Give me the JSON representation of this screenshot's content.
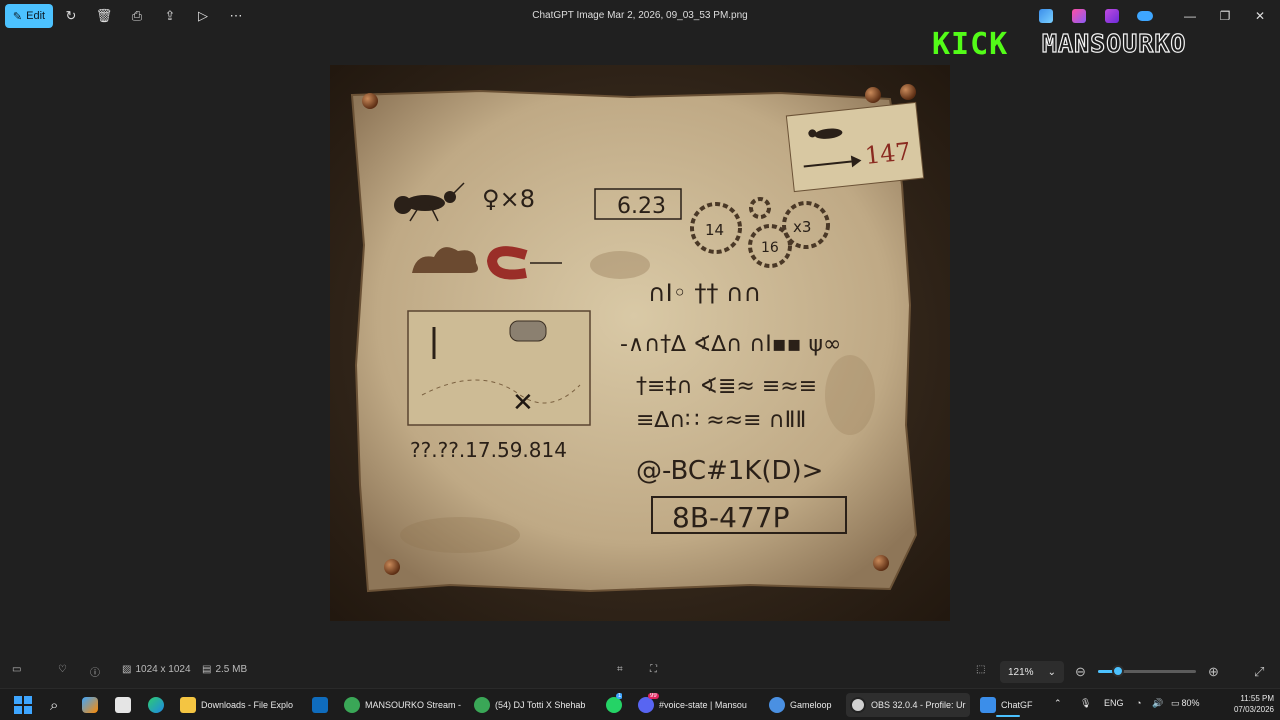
{
  "app": {
    "title": "ChatGPT Image Mar 2, 2026, 09_03_53 PM.png",
    "edit_label": "Edit"
  },
  "toolbar": {
    "icons": [
      "rotate-icon",
      "delete-icon",
      "print-icon",
      "share-icon",
      "slideshow-icon",
      "more-icon"
    ]
  },
  "overlay": {
    "kick": "KICK",
    "name": "MANSOURKO"
  },
  "image_content": {
    "note_number": "147",
    "number_box": "6.23",
    "gear_numbers": [
      "14",
      "16",
      "x3"
    ],
    "symbol_text": "♀×8",
    "coordinates": "??.??.17.59.814",
    "code_line": "@-BC#1K(D)>",
    "boxed_code": "8B-477P",
    "rows": [
      "∩Ⅰ◦ †† ∩∩",
      "-∧∩†∆ ∢∆∩ ∩Ⅰ▪▪ ψ∞",
      "†≡‡∩ ∢≣≈ ≡≈≡",
      "≡∆∩∷ ≈≈≡ ∩ⅡⅡ"
    ]
  },
  "bottom": {
    "dimensions": "1024 x 1024",
    "size": "2.5 MB",
    "zoom": "121%",
    "zoom_level": 0.2
  },
  "taskbar": {
    "items": [
      {
        "label": "Downloads - File Explo",
        "color": "#f4c542"
      },
      {
        "label": "MANSOURKO Stream -",
        "color": "#3aa757"
      },
      {
        "label": "(54) DJ Totti X Shehab",
        "color": "#3aa757"
      },
      {
        "label": "#voice-state | Mansou",
        "color": "#5865f2"
      },
      {
        "label": "Gameloop",
        "color": "#4a90e2"
      },
      {
        "label": "OBS 32.0.4 - Profile: Ur",
        "color": "#d0d0d0"
      },
      {
        "label": "ChatGF",
        "color": "#3b8eea"
      }
    ],
    "badges": {
      "whatsapp": "1",
      "discord": "99"
    },
    "lang": "ENG",
    "battery": "80%",
    "time": "11:55 PM",
    "date": "07/03/2026"
  }
}
